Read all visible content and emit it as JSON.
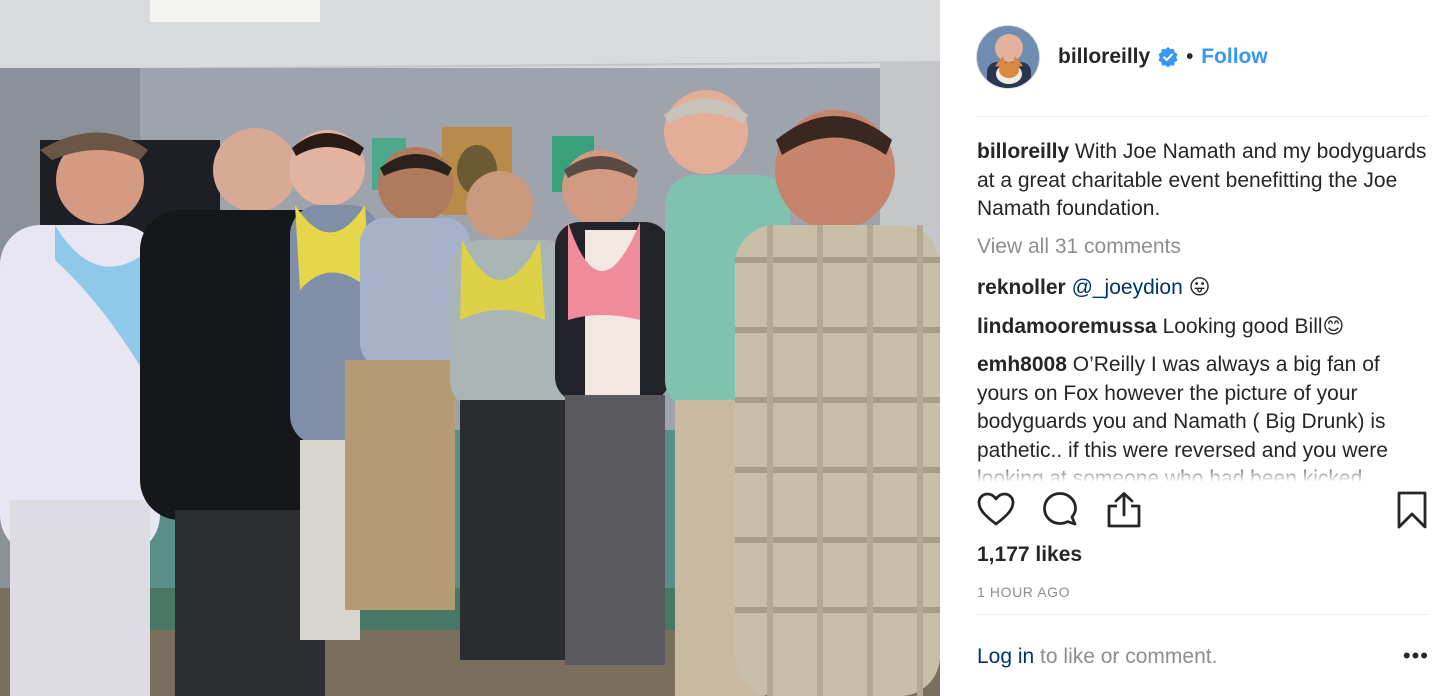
{
  "post": {
    "username": "billoreilly",
    "follow_label": "Follow",
    "separator": "•",
    "caption_user": "billoreilly",
    "caption_text": "With Joe Namath and my bodyguards at a great charitable event benefitting the Joe Namath foundation.",
    "view_all_comments": "View all 31 comments",
    "comments": [
      {
        "user": "reknoller",
        "mention": "@_joeydion",
        "text": "",
        "emoji": "😛"
      },
      {
        "user": "lindamooremussa",
        "mention": "",
        "text": "Looking good Bill",
        "emoji": "😊"
      },
      {
        "user": "emh8008",
        "mention": "",
        "text": "O’Reilly I was always a big fan of yours on Fox however the picture of your bodyguards you and Namath ( Big Drunk) is pathetic.. if this were reversed and you were looking at someone who had been kicked",
        "emoji": ""
      }
    ],
    "likes": "1,177 likes",
    "timestamp": "1 HOUR AGO",
    "login_link": "Log in",
    "login_text": " to like or comment.",
    "more_label": "•••"
  },
  "icons": {
    "like": "heart-icon",
    "comment": "comment-bubble-icon",
    "share": "share-icon",
    "save": "bookmark-icon",
    "verified": "verified-badge-icon",
    "more": "more-options-icon"
  },
  "colors": {
    "accent": "#3897f0",
    "link": "#003569",
    "muted": "#8e8e8e",
    "text": "#262626"
  }
}
